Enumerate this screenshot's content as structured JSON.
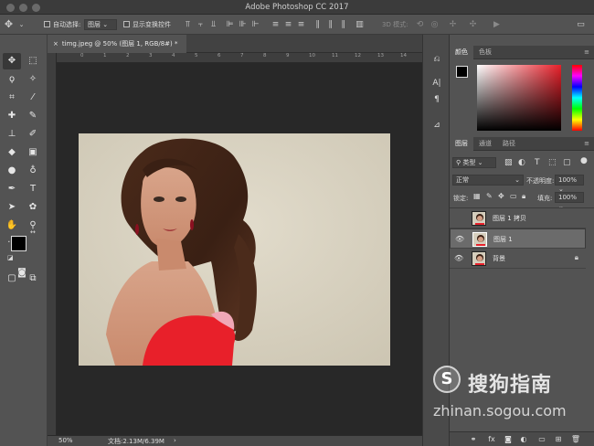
{
  "app": {
    "title": "Adobe Photoshop CC 2017"
  },
  "options_bar": {
    "auto_select_label": "自动选择:",
    "auto_select_value": "图层",
    "show_transform_label": "显示变换控件",
    "mode_3d_label": "3D 模式:"
  },
  "document": {
    "tab_label": "timg.jpeg @ 50% (图层 1, RGB/8#) *",
    "zoom": "50%",
    "doc_info": "文档:2.13M/6.39M",
    "ruler_marks": [
      "0",
      "1",
      "2",
      "3",
      "4",
      "5",
      "6",
      "7",
      "8",
      "9",
      "10",
      "11",
      "12",
      "13",
      "14"
    ]
  },
  "color_panel": {
    "tabs": [
      "颜色",
      "色板"
    ],
    "accent": "#e8202a"
  },
  "layers_panel": {
    "tabs": [
      "图层",
      "通道",
      "路径"
    ],
    "filter_kind": "类型",
    "blend_mode": "正常",
    "opacity_label": "不透明度:",
    "opacity_value": "100%",
    "lock_label": "锁定:",
    "fill_label": "填充:",
    "fill_value": "100%",
    "layers": [
      {
        "name": "图层 1 拷贝",
        "visible": false,
        "selected": false
      },
      {
        "name": "图层 1",
        "visible": true,
        "selected": true
      },
      {
        "name": "背景",
        "visible": true,
        "selected": false,
        "locked": true
      }
    ]
  },
  "watermark": {
    "brand": "搜狗指南",
    "url": "zhinan.sogou.com"
  }
}
